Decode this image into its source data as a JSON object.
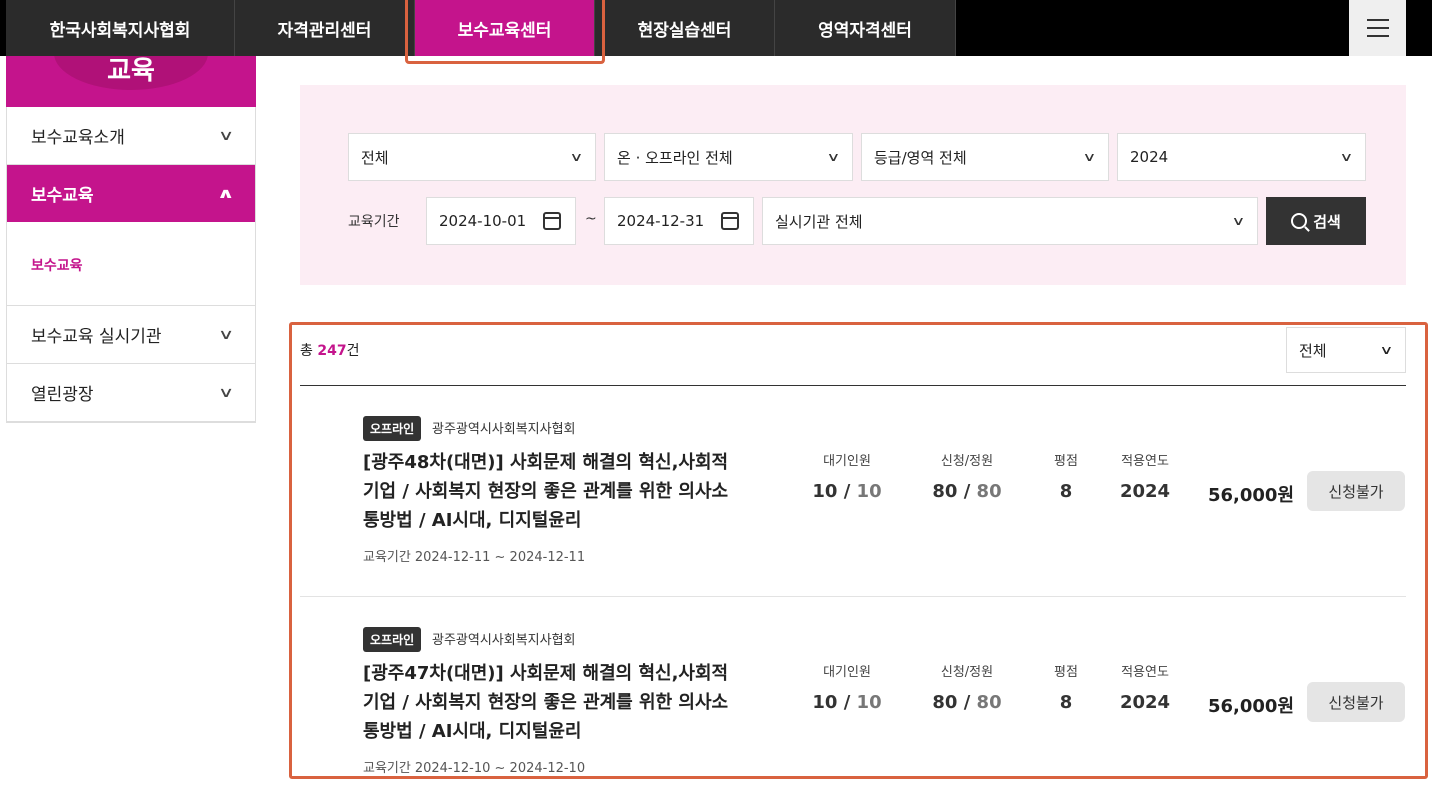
{
  "nav": {
    "items": [
      "한국사회복지사협회",
      "자격관리센터",
      "보수교육센터",
      "현장실습센터",
      "영역자격센터"
    ],
    "active_index": 2
  },
  "sidebar": {
    "header_title": "교육",
    "items": [
      {
        "label": "보수교육소개",
        "expanded": false
      },
      {
        "label": "보수교육",
        "expanded": true,
        "sub": [
          "보수교육"
        ]
      },
      {
        "label": "보수교육 실시기관",
        "expanded": false
      },
      {
        "label": "열린광장",
        "expanded": false
      }
    ]
  },
  "filters": {
    "category": "전체",
    "mode": "온 · 오프라인 전체",
    "grade": "등급/영역 전체",
    "year": "2024",
    "period_label": "교육기간",
    "start_date": "2024-10-01",
    "tilde": "~",
    "end_date": "2024-12-31",
    "institution": "실시기관 전체",
    "search_label": "검색"
  },
  "results": {
    "count_prefix": "총 ",
    "count": "247",
    "count_suffix": "건",
    "sort": "전체"
  },
  "courses": [
    {
      "badge": "오프라인",
      "org": "광주광역시사회복지사협회",
      "title": "[광주48차(대면)] 사회문제 해결의 혁신,사회적 기업 / 사회복지 현장의 좋은 관계를 위한 의사소통방법 / AI시대, 디지털윤리",
      "period_label": "교육기간",
      "period": "2024-12-11 ~ 2024-12-11",
      "wait_label": "대기인원",
      "wait_cur": "10",
      "wait_max": "10",
      "apply_label": "신청/정원",
      "apply_cur": "80",
      "apply_max": "80",
      "score_label": "평점",
      "score": "8",
      "year_label": "적용연도",
      "year": "2024",
      "price": "56,000원",
      "button": "신청불가"
    },
    {
      "badge": "오프라인",
      "org": "광주광역시사회복지사협회",
      "title": "[광주47차(대면)] 사회문제 해결의 혁신,사회적 기업 / 사회복지 현장의 좋은 관계를 위한 의사소통방법 / AI시대, 디지털윤리",
      "period_label": "교육기간",
      "period": "2024-12-10 ~ 2024-12-10",
      "wait_label": "대기인원",
      "wait_cur": "10",
      "wait_max": "10",
      "apply_label": "신청/정원",
      "apply_cur": "80",
      "apply_max": "80",
      "score_label": "평점",
      "score": "8",
      "year_label": "적용연도",
      "year": "2024",
      "price": "56,000원",
      "button": "신청불가"
    }
  ],
  "colors": {
    "accent": "#c4148c",
    "filter_bg": "#fcedf4",
    "highlight": "#d9623f"
  }
}
